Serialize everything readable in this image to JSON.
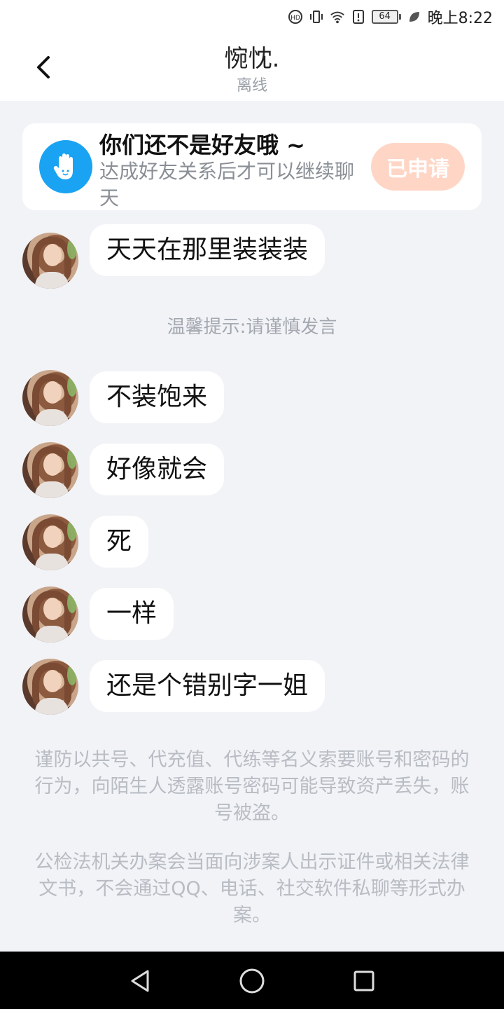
{
  "status_bar": {
    "battery_level": "64",
    "time": "晚上8:22"
  },
  "header": {
    "title": "惋忱.",
    "status": "离线"
  },
  "friend_banner": {
    "title": "你们还不是好友哦 ~",
    "description": "达成好友关系后才可以继续聊天",
    "button_label": "已申请",
    "icon": "hand-icon",
    "accent": "#1aa3f2",
    "button_color": "#ffd6c6"
  },
  "messages": [
    {
      "text": "天天在那里装装装"
    },
    {
      "text": "不装饱来"
    },
    {
      "text": "好像就会"
    },
    {
      "text": "死"
    },
    {
      "text": "一样"
    },
    {
      "text": "还是个错别字一姐"
    }
  ],
  "system_tip": "温馨提示:请谨慎发言",
  "notices": [
    "谨防以共号、代充值、代练等名义索要账号和密码的行为，向陌生人透露账号密码可能导致资产丢失，账号被盗。",
    "公检法机关办案会当面向涉案人出示证件或相关法律文书，不会通过QQ、电话、社交软件私聊等形式办案。"
  ],
  "nav": {
    "back_icon": "triangle-back-icon",
    "home_icon": "circle-home-icon",
    "recents_icon": "square-recents-icon"
  }
}
